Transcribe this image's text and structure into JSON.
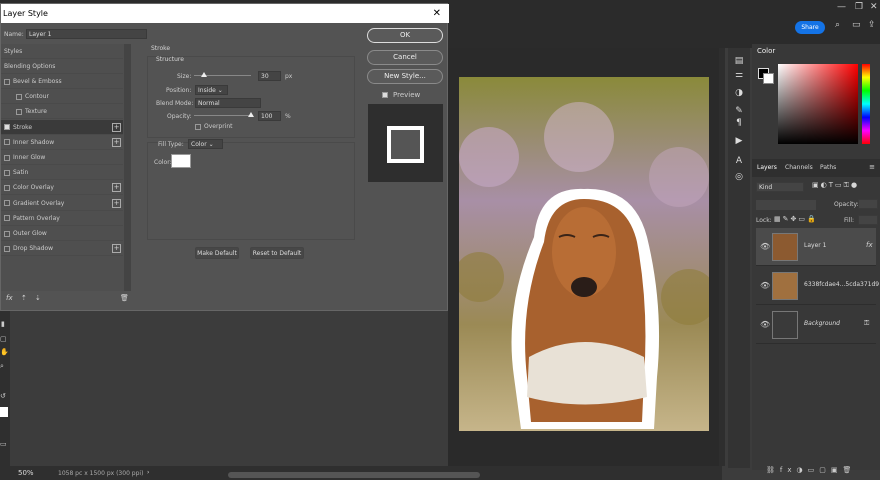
{
  "photoshop": {
    "share_label": "Share",
    "zoom": "50%",
    "doc_info": "1058 pc x 1500 px (300 ppi)"
  },
  "panels": {
    "color_tab": "Color",
    "tabs": [
      "Layers",
      "Channels",
      "Paths"
    ],
    "layers_kind": "Kind",
    "layers_opacity": "Opacity:",
    "layers_fill": "Fill:",
    "layers_lock": "Lock:",
    "layers": [
      {
        "name": "Layer 1",
        "fx": "fx",
        "selected": true
      },
      {
        "name": "6338fcdae4...5cda371d9",
        "fx": "",
        "selected": false
      },
      {
        "name": "Background",
        "fx": "",
        "selected": false
      }
    ]
  },
  "dialog": {
    "title": "Layer Style",
    "name_label": "Name:",
    "name_value": "Layer 1",
    "styles_header": "Styles",
    "blending_options": "Blending Options",
    "style_items": [
      {
        "label": "Bevel & Emboss",
        "checked": false,
        "plus": false,
        "indent": 0
      },
      {
        "label": "Contour",
        "checked": false,
        "plus": false,
        "indent": 1
      },
      {
        "label": "Texture",
        "checked": false,
        "plus": false,
        "indent": 1
      },
      {
        "label": "Stroke",
        "checked": true,
        "plus": true,
        "indent": 0
      },
      {
        "label": "Inner Shadow",
        "checked": false,
        "plus": true,
        "indent": 0
      },
      {
        "label": "Inner Glow",
        "checked": false,
        "plus": false,
        "indent": 0
      },
      {
        "label": "Satin",
        "checked": false,
        "plus": false,
        "indent": 0
      },
      {
        "label": "Color Overlay",
        "checked": false,
        "plus": true,
        "indent": 0
      },
      {
        "label": "Gradient Overlay",
        "checked": false,
        "plus": true,
        "indent": 0
      },
      {
        "label": "Pattern Overlay",
        "checked": false,
        "plus": false,
        "indent": 0
      },
      {
        "label": "Outer Glow",
        "checked": false,
        "plus": false,
        "indent": 0
      },
      {
        "label": "Drop Shadow",
        "checked": false,
        "plus": true,
        "indent": 0
      }
    ],
    "section_title": "Stroke",
    "structure_title": "Structure",
    "size_label": "Size:",
    "size_value": "30",
    "size_unit": "px",
    "position_label": "Position:",
    "position_value": "Inside",
    "blend_label": "Blend Mode:",
    "blend_value": "Normal",
    "opacity_label": "Opacity:",
    "opacity_value": "100",
    "opacity_unit": "%",
    "overprint_label": "Overprint",
    "fill_type_label": "Fill Type:",
    "fill_type_value": "Color",
    "color_label": "Color:",
    "stroke_color": "#ffffff",
    "make_default": "Make Default",
    "reset_default": "Reset to Default",
    "ok_label": "OK",
    "cancel_label": "Cancel",
    "new_style_label": "New Style...",
    "preview_label": "Preview",
    "footer_fx": "fx"
  }
}
